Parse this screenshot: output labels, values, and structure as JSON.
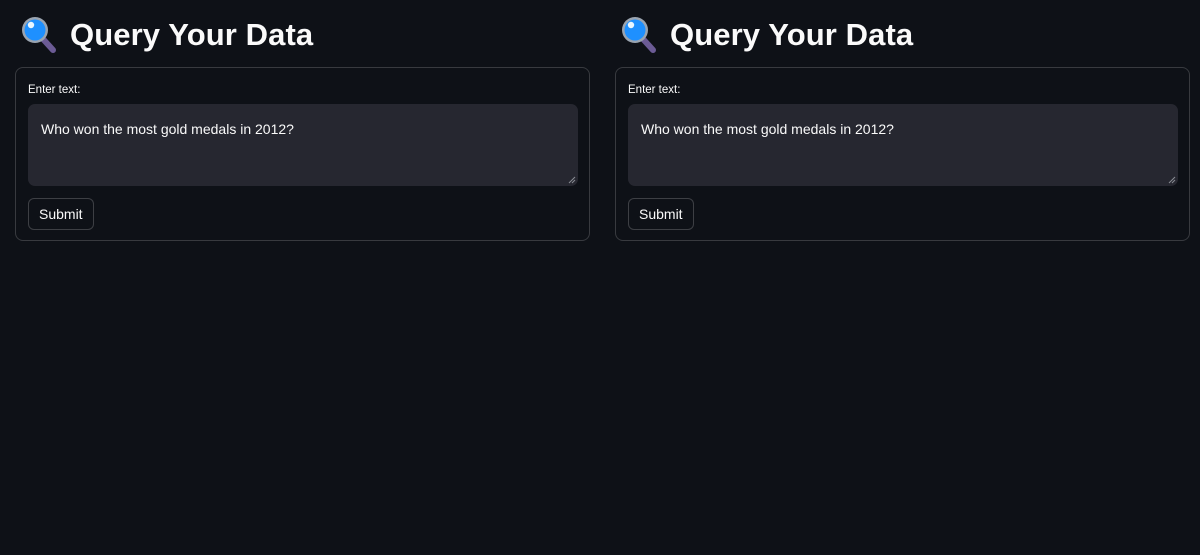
{
  "panels": [
    {
      "icon": "magnifying-glass-icon",
      "title": "Query Your Data",
      "input_label": "Enter text:",
      "input_value": "Who won the most gold medals in 2012?",
      "submit_label": "Submit"
    },
    {
      "icon": "magnifying-glass-icon",
      "title": "Query Your Data",
      "input_label": "Enter text:",
      "input_value": "Who won the most gold medals in 2012?",
      "submit_label": "Submit"
    }
  ],
  "colors": {
    "background": "#0e1117",
    "input_background": "#262730",
    "text": "#fafafa",
    "icon_lens": "#1e90ff",
    "icon_handle": "#6b5b95"
  }
}
